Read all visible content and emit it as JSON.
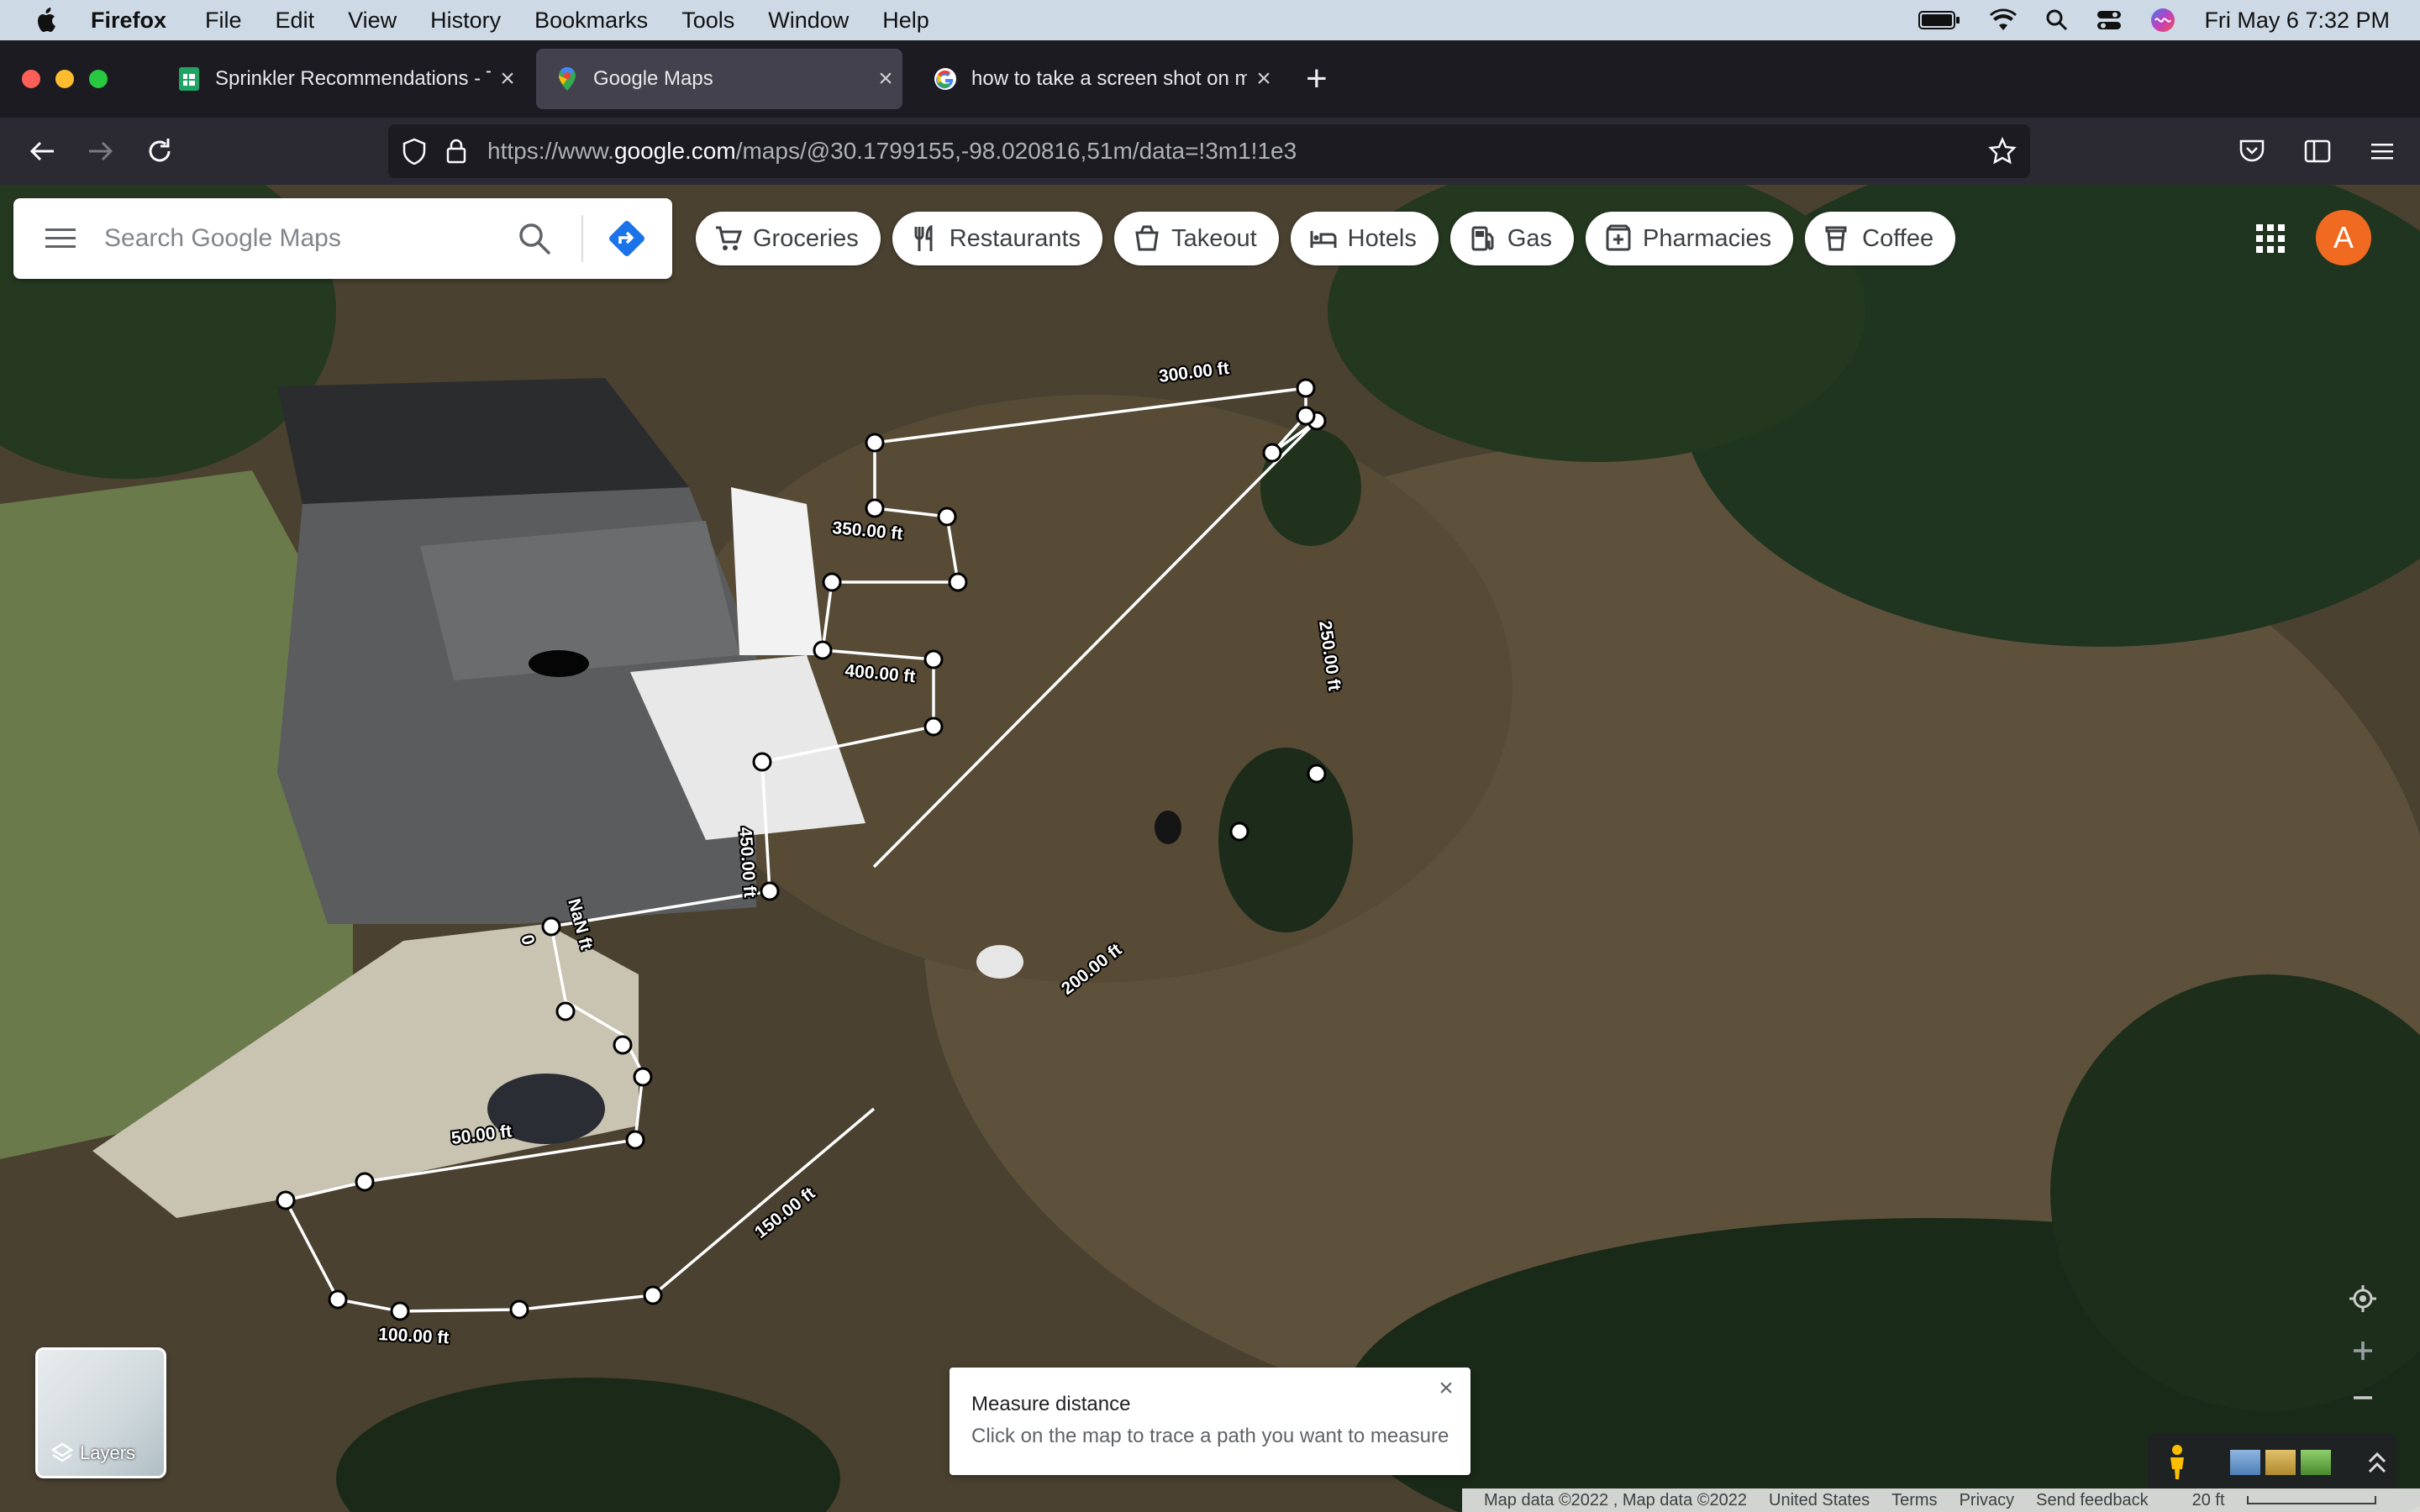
{
  "menubar": {
    "app": "Firefox",
    "items": [
      "File",
      "Edit",
      "View",
      "History",
      "Bookmarks",
      "Tools",
      "Window",
      "Help"
    ],
    "clock": "Fri May 6  7:32 PM"
  },
  "tabs": [
    {
      "label": "Sprinkler Recommendations - Th",
      "icon": "sheets-icon",
      "active": false
    },
    {
      "label": "Google Maps",
      "icon": "maps-pin-icon",
      "active": true
    },
    {
      "label": "how to take a screen shot on ma",
      "icon": "google-g-icon",
      "active": false
    }
  ],
  "url": {
    "prefix": "https://www.",
    "domain": "google.com",
    "path": "/maps/@30.1799155,-98.020816,51m/data=!3m1!1e3"
  },
  "search": {
    "placeholder": "Search Google Maps"
  },
  "chips": [
    {
      "label": "Groceries",
      "icon": "cart-icon"
    },
    {
      "label": "Restaurants",
      "icon": "fork-knife-icon"
    },
    {
      "label": "Takeout",
      "icon": "takeout-bag-icon"
    },
    {
      "label": "Hotels",
      "icon": "bed-icon"
    },
    {
      "label": "Gas",
      "icon": "gas-pump-icon"
    },
    {
      "label": "Pharmacies",
      "icon": "pharmacy-icon"
    },
    {
      "label": "Coffee",
      "icon": "coffee-cup-icon"
    }
  ],
  "account": {
    "initial": "A",
    "color": "#f06a22"
  },
  "measure_labels": [
    "300.00 ft",
    "350.00 ft",
    "400.00 ft",
    "250.00 ft",
    "450.00 ft",
    "NaN ft",
    "0",
    "200.00 ft",
    "50.00 ft",
    "150.00 ft",
    "100.00 ft"
  ],
  "layers": {
    "label": "Layers"
  },
  "measure_box": {
    "title": "Measure distance",
    "subtitle": "Click on the map to trace a path you want to measure"
  },
  "footer": {
    "data": "Map data ©2022 , Map data ©2022",
    "country": "United States",
    "terms": "Terms",
    "privacy": "Privacy",
    "feedback": "Send feedback",
    "scale": "20 ft"
  },
  "colors": {
    "accent": "#1a73e8",
    "avatar": "#f06a22"
  }
}
